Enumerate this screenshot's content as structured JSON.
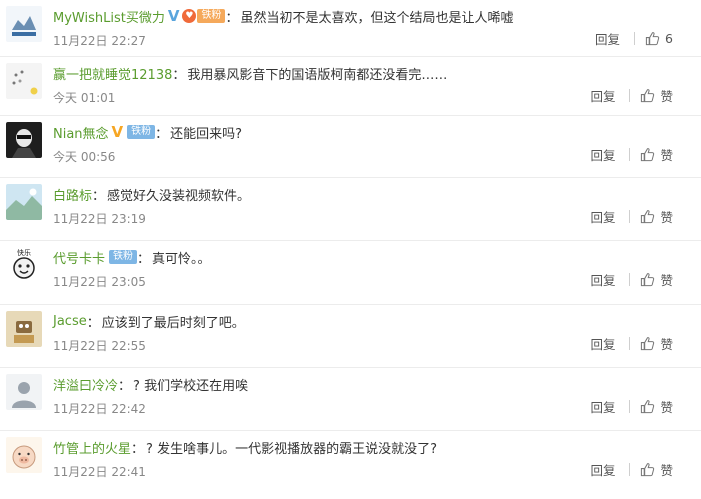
{
  "comments": [
    {
      "user": "MyWishList买微力",
      "verified": "V",
      "badge": "铁粉",
      "text": "虽然当初不是太喜欢，但这个结局也是让人唏嘘",
      "time": "11月22日 22:27",
      "reply_label": "回复",
      "likes": "6"
    },
    {
      "user": "赢一把就睡觉12138",
      "text": "我用暴风影音下的国语版柯南都还没看完……",
      "time": "今天 01:01",
      "reply_label": "回复",
      "likes": "赞"
    },
    {
      "user": "Nian無念",
      "verified": "V",
      "badge": "铁粉",
      "text": "还能回来吗?",
      "time": "今天 00:56",
      "reply_label": "回复",
      "likes": "赞"
    },
    {
      "user": "白路标",
      "text": "感觉好久没装视频软件。",
      "time": "11月22日 23:19",
      "reply_label": "回复",
      "likes": "赞"
    },
    {
      "user": "代号卡卡",
      "badge": "铁粉",
      "text": "真可怜。。",
      "time": "11月22日 23:05",
      "reply_label": "回复",
      "likes": "赞"
    },
    {
      "user": "Jacse",
      "text": "应该到了最后时刻了吧。",
      "time": "11月22日 22:55",
      "reply_label": "回复",
      "likes": "赞"
    },
    {
      "user": "洋溢曰冷冷",
      "text": "? 我们学校还在用唉",
      "time": "11月22日 22:42",
      "reply_label": "回复",
      "likes": "赞"
    },
    {
      "user": "竹管上的火星",
      "text": "? 发生啥事儿。一代影视播放器的霸王说没就没了?",
      "time": "11月22日 22:41",
      "reply_label": "回复",
      "likes": "赞"
    }
  ],
  "avatar_labels": {
    "c4": "快乐"
  },
  "colon": "：",
  "icons": {
    "like": "thumbs-up-icon"
  },
  "colors": {
    "username": "#5a9c2e",
    "badge": "#7eb6e5",
    "verified_orange": "#f6a623"
  }
}
